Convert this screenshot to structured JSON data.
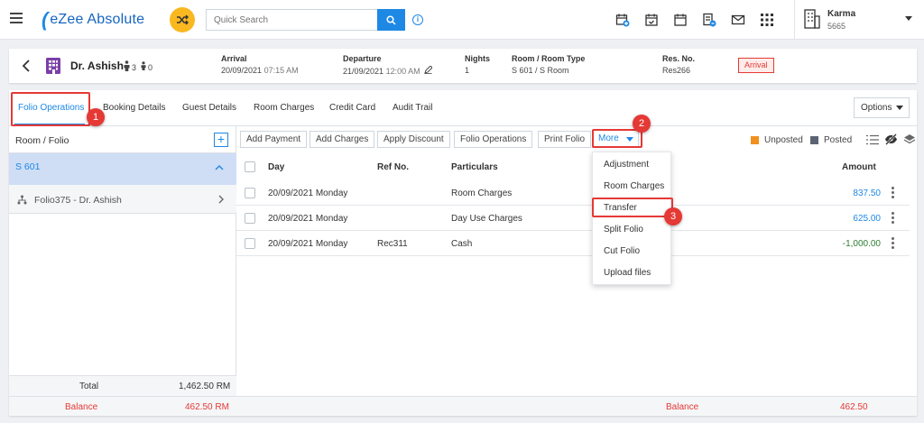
{
  "app": {
    "logo_text": "eZee Absolute",
    "search_placeholder": "Quick Search",
    "user": {
      "name": "Karma",
      "code": "5665"
    },
    "top_icons": [
      "calendar-add-icon",
      "calendar-check-icon",
      "calendar-icon",
      "document-badge-icon",
      "mail-icon",
      "apps-grid-icon"
    ]
  },
  "reservation": {
    "guest_name": "Dr. Ashish",
    "adults": "3",
    "children": "0",
    "arrival_label": "Arrival",
    "arrival_date": "20/09/2021",
    "arrival_time": "07:15 AM",
    "departure_label": "Departure",
    "departure_date": "21/09/2021",
    "departure_time": "12:00 AM",
    "nights_label": "Nights",
    "nights": "1",
    "room_label": "Room / Room Type",
    "room": "S 601 / S Room",
    "resno_label": "Res. No.",
    "resno": "Res266",
    "status": "Arrival"
  },
  "tabs": [
    "Folio Operations",
    "Booking Details",
    "Guest Details",
    "Room Charges",
    "Credit Card",
    "Audit Trail"
  ],
  "options_label": "Options",
  "left_pane": {
    "title": "Room / Folio",
    "room": "S 601",
    "folio": "Folio375 - Dr. Ashish",
    "total_label": "Total",
    "total_value": "1,462.50 RM",
    "balance_label": "Balance",
    "balance_value": "462.50 RM"
  },
  "toolbar": {
    "add_payment": "Add Payment",
    "add_charges": "Add Charges",
    "apply_discount": "Apply Discount",
    "folio_operations": "Folio Operations",
    "print_folio": "Print Folio",
    "more": "More",
    "unposted": "Unposted",
    "posted": "Posted"
  },
  "table": {
    "headers": {
      "day": "Day",
      "ref": "Ref No.",
      "particulars": "Particulars",
      "amount": "Amount"
    },
    "rows": [
      {
        "day": "20/09/2021 Monday",
        "ref": "",
        "particulars": "Room Charges",
        "amount": "837.50"
      },
      {
        "day": "20/09/2021 Monday",
        "ref": "",
        "particulars": "Day Use Charges",
        "amount": "625.00"
      },
      {
        "day": "20/09/2021 Monday",
        "ref": "Rec311",
        "particulars": "Cash",
        "amount": "-1,000.00"
      }
    ],
    "balance_label": "Balance",
    "balance_value": "462.50"
  },
  "more_menu": [
    "Adjustment",
    "Room Charges",
    "Transfer",
    "Split Folio",
    "Cut Folio",
    "Upload files"
  ],
  "callouts": [
    "1",
    "2",
    "3"
  ],
  "colors": {
    "primary": "#1e88e5",
    "accent": "#f9b820",
    "alert": "#e53935",
    "unposted": "#f0901e",
    "posted": "#5a6473",
    "positive": "#2e7d32"
  }
}
